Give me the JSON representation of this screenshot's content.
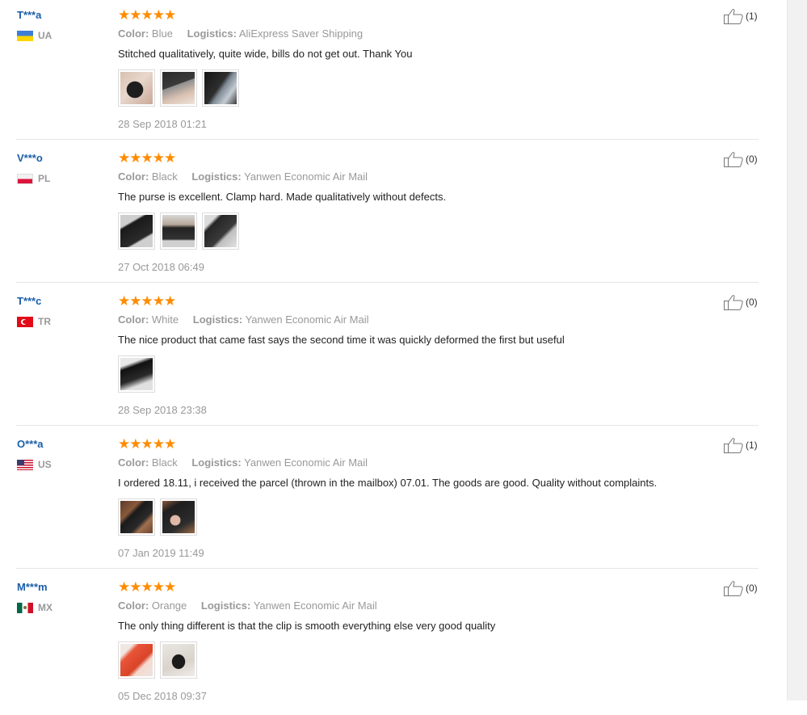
{
  "labels": {
    "color": "Color:",
    "logistics": "Logistics:"
  },
  "reviews": [
    {
      "user": "T***a",
      "country": "UA",
      "flag": "ua",
      "stars": "★★★★★",
      "color": "Blue",
      "logistics": "AliExpress Saver Shipping",
      "text": "Stitched qualitatively, quite wide, bills do not get out. Thank You",
      "photos": 3,
      "date": "28 Sep 2018 01:21",
      "likes": "(1)"
    },
    {
      "user": "V***o",
      "country": "PL",
      "flag": "pl",
      "stars": "★★★★★",
      "color": "Black",
      "logistics": "Yanwen Economic Air Mail",
      "text": "The purse is excellent. Clamp hard. Made qualitatively without defects.",
      "photos": 3,
      "date": "27 Oct 2018 06:49",
      "likes": "(0)"
    },
    {
      "user": "T***c",
      "country": "TR",
      "flag": "tr",
      "stars": "★★★★★",
      "color": "White",
      "logistics": "Yanwen Economic Air Mail",
      "text": "The nice product that came fast says the second time it was quickly deformed the first but useful",
      "photos": 1,
      "date": "28 Sep 2018 23:38",
      "likes": "(0)"
    },
    {
      "user": "O***a",
      "country": "US",
      "flag": "us",
      "stars": "★★★★★",
      "color": "Black",
      "logistics": "Yanwen Economic Air Mail",
      "text": "I ordered 18.11, i received the parcel (thrown in the mailbox) 07.01. The goods are good. Quality without complaints.",
      "photos": 2,
      "date": "07 Jan 2019 11:49",
      "likes": "(1)"
    },
    {
      "user": "M***m",
      "country": "MX",
      "flag": "mx",
      "stars": "★★★★★",
      "color": "Orange",
      "logistics": "Yanwen Economic Air Mail",
      "text": "The only thing different is that the clip is smooth everything else very good quality",
      "photos": 2,
      "date": "05 Dec 2018 09:37",
      "likes": "(0)"
    }
  ]
}
